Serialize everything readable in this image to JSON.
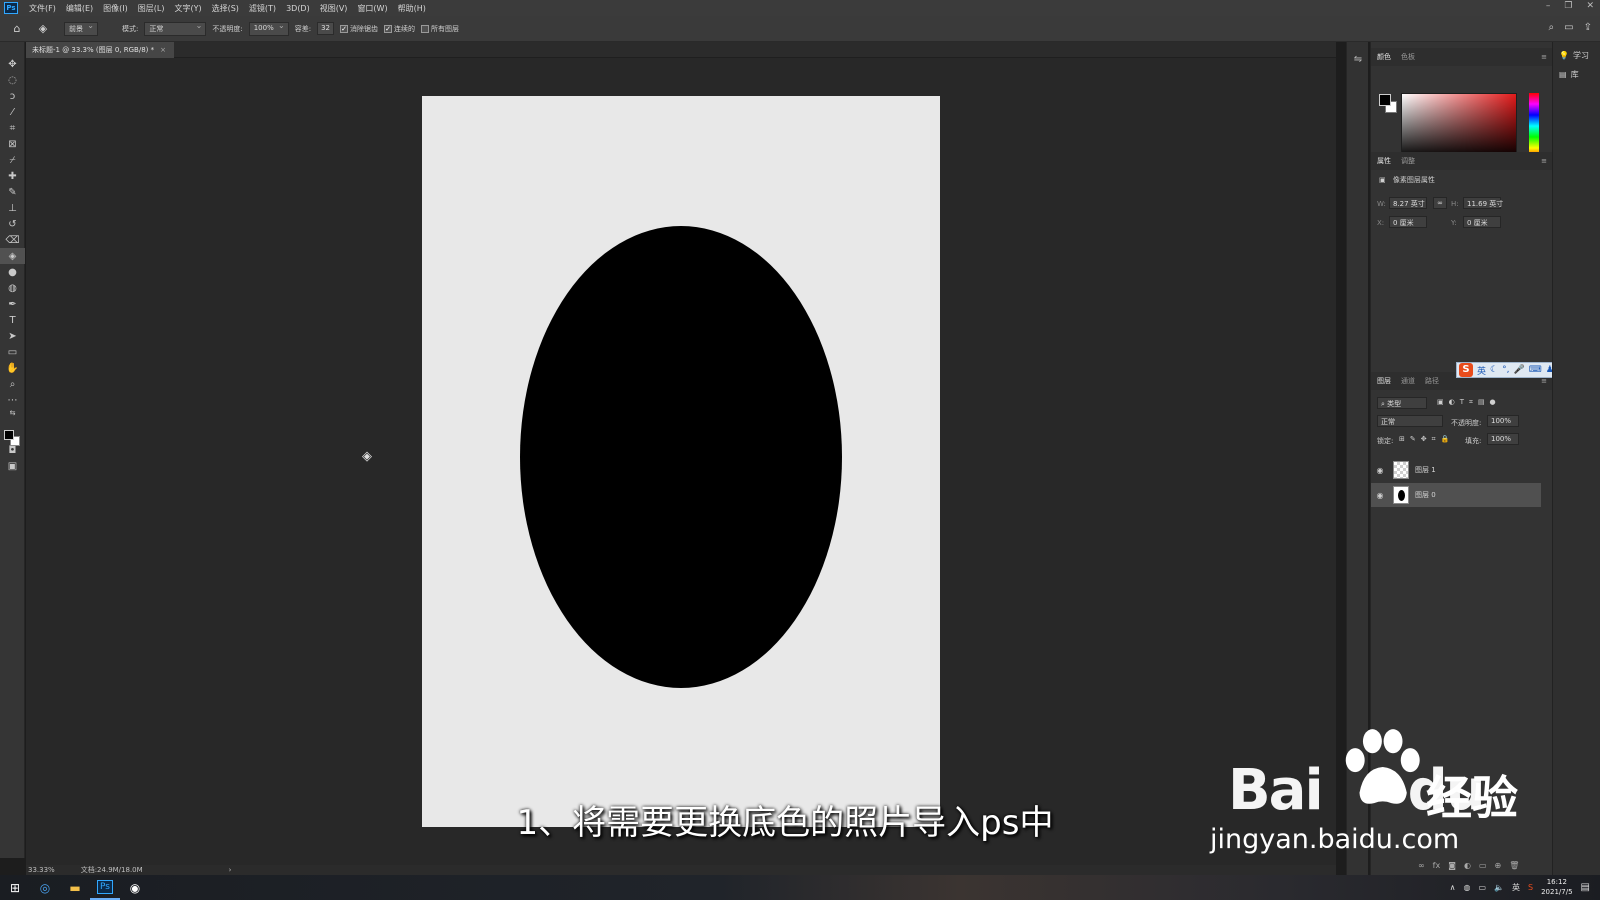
{
  "app": {
    "logo": "Ps"
  },
  "menu": [
    "文件(F)",
    "编辑(E)",
    "图像(I)",
    "图层(L)",
    "文字(Y)",
    "选择(S)",
    "滤镜(T)",
    "3D(D)",
    "视图(V)",
    "窗口(W)",
    "帮助(H)"
  ],
  "window_controls": {
    "minimize": "–",
    "restore": "❐",
    "close": "✕"
  },
  "options": {
    "tool_preset": "前景",
    "mode_label": "模式:",
    "mode_value": "正常",
    "opacity_label": "不透明度:",
    "opacity_value": "100%",
    "tolerance_label": "容差:",
    "tolerance_value": "32",
    "antialias_label": "消除锯齿",
    "contiguous_label": "连续的",
    "all_layers_label": "所有图层",
    "antialias_checked": true,
    "contiguous_checked": true,
    "all_layers_checked": false
  },
  "document": {
    "tab_title": "未标题-1 @ 33.3% (图层 0, RGB/8) *",
    "close": "×",
    "ellipse_color": "#000000",
    "canvas_color": "#e8e8e8"
  },
  "subtitle": "1、将需要更换底色的照片导入ps中",
  "status": {
    "zoom": "33.33%",
    "doc_size": "文档:24.9M/18.0M",
    "arrow": "›"
  },
  "color_panel": {
    "tabs": [
      "颜色",
      "色板"
    ],
    "active_tab": "颜色",
    "fg": "#000000",
    "bg": "#ffffff"
  },
  "properties_panel": {
    "tabs": [
      "属性",
      "调整"
    ],
    "title": "像素图层属性",
    "w_label": "W:",
    "w_value": "8.27 英寸",
    "h_label": "H:",
    "h_value": "11.69 英寸",
    "x_label": "X:",
    "x_value": "0 厘米",
    "y_label": "Y:",
    "y_value": "0 厘米"
  },
  "ime": {
    "logo": "S",
    "lang": "英"
  },
  "layers_panel": {
    "tabs": [
      "图层",
      "通道",
      "路径"
    ],
    "filter": "类型",
    "blend_mode": "正常",
    "opacity_label": "不透明度:",
    "opacity_value": "100%",
    "lock_label": "锁定:",
    "fill_label": "填充:",
    "fill_value": "100%",
    "layers": [
      {
        "name": "图层 1",
        "selected": false
      },
      {
        "name": "图层 0",
        "selected": true
      }
    ]
  },
  "far_dock": {
    "learn": "学习",
    "library": "库"
  },
  "watermark": {
    "logo": "Bai",
    "logo2": "du",
    "cn": "经验",
    "url": "jingyan.baidu.com"
  },
  "taskbar": {
    "time": "16:12",
    "date": "2021/7/5"
  }
}
